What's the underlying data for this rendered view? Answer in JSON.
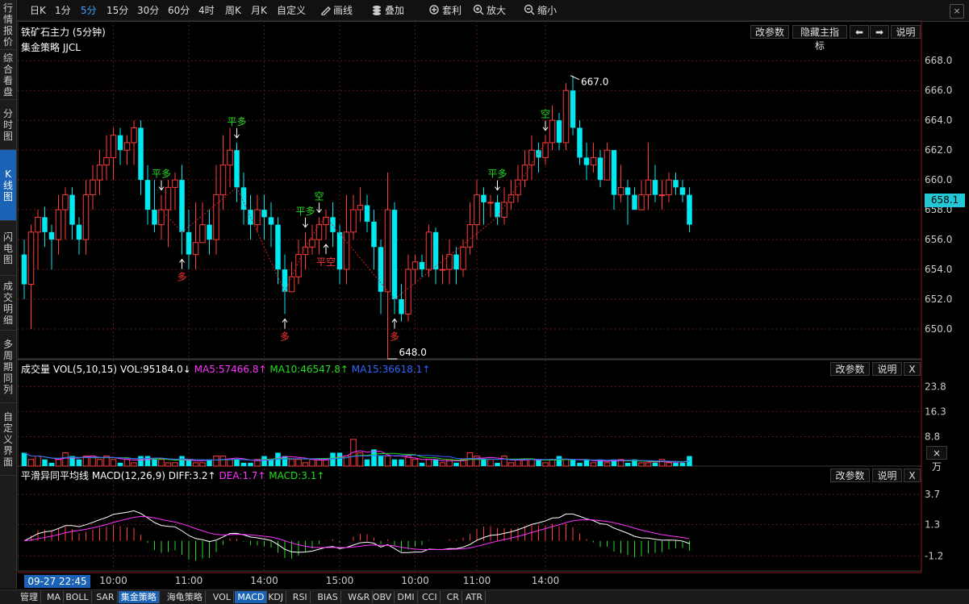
{
  "sidebar": {
    "tabs": [
      {
        "label": "行情报价",
        "active": false
      },
      {
        "label": "综合看盘",
        "active": false
      },
      {
        "label": "分时图",
        "active": false
      },
      {
        "label": "K线图",
        "active": true
      },
      {
        "label": "闪电图",
        "active": false
      },
      {
        "label": "成交明细",
        "active": false
      },
      {
        "label": "多周期同列",
        "active": false
      },
      {
        "label": "自定义界面",
        "active": false
      }
    ]
  },
  "toolbar": {
    "periods": [
      "日K",
      "1分",
      "5分",
      "15分",
      "30分",
      "60分",
      "4时",
      "周K",
      "月K",
      "自定义"
    ],
    "active_period": "5分",
    "tools": [
      {
        "label": "画线",
        "icon": "pencil-icon"
      },
      {
        "label": "叠加",
        "icon": "stack-icon"
      },
      {
        "label": "套利",
        "icon": "arbitrage-icon"
      },
      {
        "label": "放大",
        "icon": "zoom-in-icon"
      },
      {
        "label": "缩小",
        "icon": "zoom-out-icon"
      }
    ],
    "close": "×"
  },
  "main_panel": {
    "title": "铁矿石主力 (5分钟)",
    "strategy": "集金策略 JJCL",
    "buttons": {
      "params": "改参数",
      "hide": "隐藏主指标",
      "prev": "⬅",
      "next": "➡",
      "help": "说明"
    },
    "last_price": "658.1",
    "high_label": "667.0",
    "low_label": "648.0",
    "signals": [
      {
        "text": "平多",
        "i": 20,
        "dir": "down",
        "color": "#22dd22"
      },
      {
        "text": "多",
        "i": 23,
        "dir": "up",
        "color": "#ff3333"
      },
      {
        "text": "平多",
        "i": 31,
        "dir": "down",
        "color": "#22dd22"
      },
      {
        "text": "多",
        "i": 38,
        "dir": "up",
        "color": "#ff3333"
      },
      {
        "text": "平多",
        "i": 41,
        "dir": "down",
        "color": "#22dd22"
      },
      {
        "text": "空",
        "i": 43,
        "dir": "down",
        "color": "#22dd22"
      },
      {
        "text": "平空",
        "i": 44,
        "dir": "up",
        "color": "#ff3333"
      },
      {
        "text": "多",
        "i": 54,
        "dir": "up",
        "color": "#ff3333"
      },
      {
        "text": "平多",
        "i": 69,
        "dir": "down",
        "color": "#22dd22"
      },
      {
        "text": "空",
        "i": 76,
        "dir": "down",
        "color": "#22dd22"
      }
    ]
  },
  "vol_panel": {
    "title": "成交量 VOL(5,10,15)",
    "vol": "VOL:95184.0↓",
    "ma5": "MA5:57466.8↑",
    "ma10": "MA10:46547.8↑",
    "ma15": "MA15:36618.1↑",
    "unit": "×万",
    "buttons": {
      "params": "改参数",
      "help": "说明",
      "close": "X"
    }
  },
  "macd_panel": {
    "title": "平滑异同平均线 MACD(12,26,9)",
    "diff": "DIFF:3.2↑",
    "dea": "DEA:1.7↑",
    "macd": "MACD:3.1↑",
    "buttons": {
      "params": "改参数",
      "help": "说明",
      "close": "X"
    }
  },
  "colors": {
    "up": "#ff3b3b",
    "down": "#00e8f0",
    "ma5": "#ff33ff",
    "ma10": "#22dd22",
    "ma15": "#3366ff",
    "diff": "#ffffff",
    "dea": "#ff33ff",
    "grid": "#5a1a1a"
  },
  "time_badge": "09-27 22:45",
  "bottom_tabs": [
    "管理",
    "MA",
    "BOLL",
    "SAR",
    "集金策略",
    "海龟策略",
    "VOL",
    "MACD",
    "KDJ",
    "RSI",
    "BIAS",
    "W&R",
    "OBV",
    "DMI",
    "CCI",
    "CR",
    "ATR"
  ],
  "bottom_active": [
    "集金策略",
    "MACD"
  ],
  "chart_data": {
    "type": "candlestick",
    "price_axis": {
      "ticks": [
        650.0,
        652.0,
        654.0,
        656.0,
        658.0,
        660.0,
        662.0,
        664.0,
        666.0,
        668.0
      ],
      "ylim": [
        648.0,
        668.5
      ]
    },
    "time_axis": {
      "labels": [
        {
          "text": "10:00",
          "i": 13
        },
        {
          "text": "11:00",
          "i": 24
        },
        {
          "text": "14:00",
          "i": 35
        },
        {
          "text": "15:00",
          "i": 46
        },
        {
          "text": "10:00",
          "i": 57
        },
        {
          "text": "11:00",
          "i": 66
        },
        {
          "text": "14:00",
          "i": 76
        }
      ]
    },
    "candles": [
      [
        655,
        653,
        656,
        652
      ],
      [
        653,
        656.5,
        657,
        650
      ],
      [
        656.5,
        657.5,
        658,
        654
      ],
      [
        657.5,
        656.5,
        658.2,
        655.5
      ],
      [
        656.5,
        656,
        657,
        654
      ],
      [
        656,
        658,
        659,
        655
      ],
      [
        658,
        659,
        659.5,
        656
      ],
      [
        659,
        657,
        659.5,
        656
      ],
      [
        657,
        656,
        657.5,
        655
      ],
      [
        656,
        659,
        660,
        655
      ],
      [
        659,
        660,
        661,
        658
      ],
      [
        660,
        661,
        662,
        659
      ],
      [
        661,
        661.5,
        663,
        660
      ],
      [
        661.5,
        663,
        663.5,
        660
      ],
      [
        663,
        662,
        663.5,
        661
      ],
      [
        662,
        662.5,
        663,
        661
      ],
      [
        662.5,
        663.5,
        664,
        661
      ],
      [
        663.5,
        660,
        664,
        659
      ],
      [
        660,
        658,
        661,
        657
      ],
      [
        658,
        657,
        660,
        656.5
      ],
      [
        657,
        658,
        659,
        656
      ],
      [
        658,
        659.5,
        660,
        655.5
      ],
      [
        659.5,
        660,
        660.5,
        658
      ],
      [
        660,
        656.5,
        661,
        655
      ],
      [
        656.5,
        655,
        658,
        654
      ],
      [
        655,
        655.8,
        658.5,
        654
      ],
      [
        655.8,
        657,
        658.5,
        656
      ],
      [
        657,
        656,
        658,
        655
      ],
      [
        656,
        659,
        661,
        655
      ],
      [
        659,
        661,
        663,
        658
      ],
      [
        661,
        662,
        663.5,
        659.5
      ],
      [
        662,
        659.5,
        662.5,
        658.5
      ],
      [
        659.5,
        658,
        660.5,
        657
      ],
      [
        658,
        657,
        659,
        656
      ],
      [
        657,
        658,
        659,
        656.5
      ],
      [
        658,
        657.5,
        659,
        656
      ],
      [
        657.5,
        657,
        658.5,
        655.5
      ],
      [
        657,
        654,
        657.5,
        653
      ],
      [
        654,
        652.5,
        655,
        651
      ],
      [
        652.5,
        653.5,
        654.5,
        652.5
      ],
      [
        653.5,
        655,
        656,
        653
      ],
      [
        655,
        655.5,
        656.5,
        654
      ],
      [
        655.5,
        656,
        657,
        655
      ],
      [
        656,
        657,
        657.5,
        655
      ],
      [
        657,
        657.5,
        658,
        656
      ],
      [
        657.5,
        656.5,
        658.5,
        655.5
      ],
      [
        656.5,
        654,
        657,
        653
      ],
      [
        654,
        656.5,
        659,
        653
      ],
      [
        656.5,
        658,
        659,
        656
      ],
      [
        658,
        658.3,
        659.5,
        657.2
      ],
      [
        658.3,
        657.2,
        659,
        656.5
      ],
      [
        657.2,
        655.5,
        658,
        654
      ],
      [
        655.5,
        652.5,
        656,
        651
      ],
      [
        652.5,
        658,
        660.5,
        648
      ],
      [
        658,
        652,
        658.5,
        651
      ],
      [
        652,
        651,
        653,
        650.5
      ],
      [
        651,
        654,
        655,
        650.5
      ],
      [
        654,
        654.5,
        655,
        653
      ],
      [
        654.5,
        654,
        655,
        653.5
      ],
      [
        654,
        656.5,
        657,
        653.5
      ],
      [
        656.5,
        654,
        656.8,
        653
      ],
      [
        654,
        654,
        655,
        653
      ],
      [
        654,
        655,
        656,
        653
      ],
      [
        655,
        654,
        655.5,
        653
      ],
      [
        654,
        655.5,
        656,
        653.5
      ],
      [
        655.5,
        657,
        658.5,
        655
      ],
      [
        657,
        659,
        660,
        656
      ],
      [
        659,
        658.5,
        659.5,
        657
      ],
      [
        658.5,
        658.5,
        659,
        657.5
      ],
      [
        658.5,
        657.5,
        659,
        657
      ],
      [
        657.5,
        658.5,
        659.5,
        657
      ],
      [
        658.5,
        659,
        660,
        658
      ],
      [
        659,
        660,
        661,
        658.5
      ],
      [
        660,
        661,
        662,
        659.5
      ],
      [
        661,
        662,
        663,
        660
      ],
      [
        662,
        661.5,
        662.5,
        660.5
      ],
      [
        661.5,
        662.5,
        663,
        661
      ],
      [
        662.5,
        664,
        665,
        662
      ],
      [
        664,
        662.5,
        664.5,
        662
      ],
      [
        662.5,
        666,
        666.5,
        662
      ],
      [
        666,
        663.5,
        667,
        663
      ],
      [
        663.5,
        661.5,
        664,
        661
      ],
      [
        661.5,
        661,
        662.5,
        660
      ],
      [
        661,
        661.5,
        662.5,
        660.5
      ],
      [
        661.5,
        660,
        662,
        659.5
      ],
      [
        660,
        662,
        662.5,
        660
      ],
      [
        662,
        659,
        662,
        658
      ],
      [
        659,
        659.5,
        661,
        658.5
      ],
      [
        659.5,
        659,
        660,
        657
      ],
      [
        659,
        658,
        659.5,
        658
      ],
      [
        658,
        659,
        660,
        658
      ],
      [
        659,
        660,
        662.5,
        658
      ],
      [
        660,
        659,
        661,
        658.5
      ],
      [
        659,
        659,
        660,
        658
      ],
      [
        659,
        660,
        660.5,
        658.5
      ],
      [
        660,
        659.5,
        660.5,
        659
      ],
      [
        659.5,
        659,
        660,
        658.5
      ],
      [
        659,
        657,
        659.5,
        656.5
      ]
    ],
    "volumes": [
      4,
      2,
      3,
      2,
      1,
      2,
      4,
      3,
      2,
      3,
      3,
      2,
      3,
      2,
      1,
      2,
      1,
      3,
      3,
      2,
      2,
      1,
      1,
      3,
      2,
      1,
      1,
      2,
      3,
      3,
      2,
      2,
      1,
      1,
      2,
      3,
      2,
      4,
      3,
      2,
      2,
      1,
      2,
      2,
      2,
      4,
      4,
      3,
      8,
      4,
      2,
      5,
      3,
      3,
      2,
      2,
      3,
      2,
      1,
      2,
      2,
      1,
      2,
      1,
      2,
      4,
      3,
      2,
      2,
      1,
      3,
      1,
      2,
      2,
      2,
      2,
      1,
      2,
      3,
      2,
      2,
      1,
      2,
      1,
      2,
      1,
      2,
      2,
      1,
      2,
      1,
      1,
      1,
      2,
      1,
      1,
      1,
      3
    ],
    "vol_axis": {
      "ticks": [
        8.8,
        16.3,
        23.8
      ],
      "ylim": [
        0,
        27
      ]
    },
    "macd_axis": {
      "ticks": [
        -1.2,
        1.3,
        3.7
      ],
      "ylim": [
        -2.4,
        4.8
      ]
    }
  }
}
